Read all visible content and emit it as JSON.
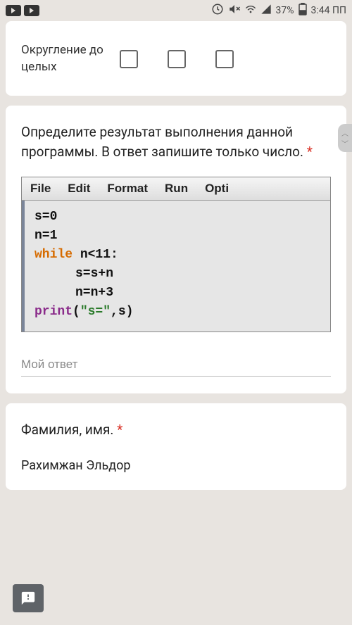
{
  "status": {
    "battery": "37%",
    "time": "3:44 ПП"
  },
  "card1": {
    "row_label": "Округление до целых"
  },
  "card2": {
    "question": "Определите результат выполнения данной программы. В ответ запишите только число.",
    "required_mark": "*",
    "code_menu": [
      "File",
      "Edit",
      "Format",
      "Run",
      "Opti"
    ],
    "code": {
      "l1": "s=0",
      "l2": "n=1",
      "l3_kw": "while",
      "l3_rest": " n<11:",
      "l4": "s=s+n",
      "l5": "n=n+3",
      "l6_fn": "print",
      "l6_p1": "(",
      "l6_str": "\"s=\"",
      "l6_p2": ",s)"
    },
    "answer_placeholder": "Мой ответ"
  },
  "card3": {
    "label": "Фамилия, имя.",
    "required_mark": "*",
    "value": "Рахимжан Эльдор"
  }
}
